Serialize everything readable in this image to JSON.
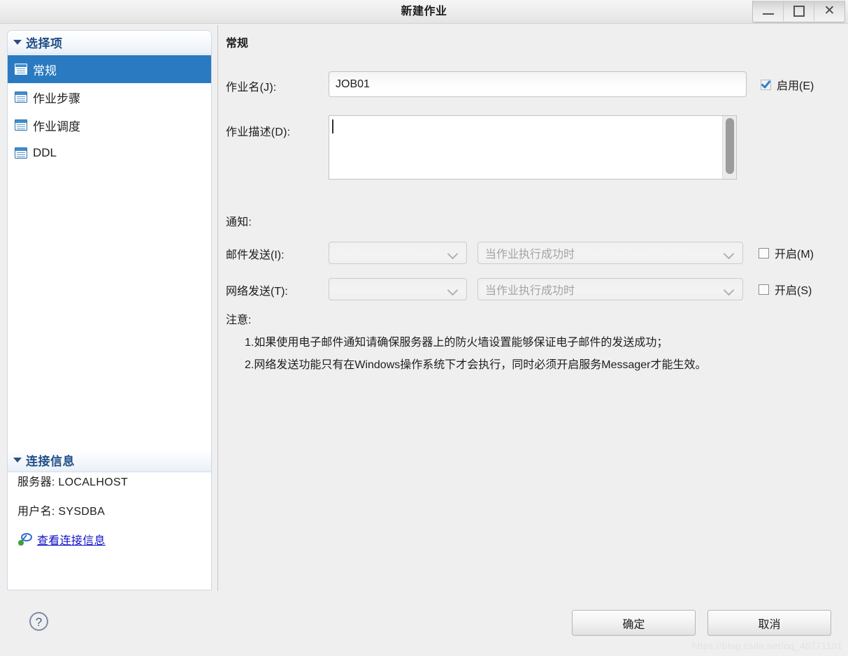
{
  "window": {
    "title": "新建作业",
    "minimize_label": "_",
    "maximize_label": "□",
    "close_label": "✕"
  },
  "sidebar": {
    "selection_section": {
      "title": "选择项",
      "items": [
        {
          "label": "常规",
          "icon": "list-form-icon",
          "selected": true
        },
        {
          "label": "作业步骤",
          "icon": "list-form-icon",
          "selected": false
        },
        {
          "label": "作业调度",
          "icon": "list-form-icon",
          "selected": false
        },
        {
          "label": "DDL",
          "icon": "list-form-icon",
          "selected": false
        }
      ]
    },
    "connection_section": {
      "title": "连接信息",
      "server_line": "服务器: LOCALHOST",
      "user_line": "用户名: SYSDBA",
      "link_label": "查看连接信息",
      "link_icon": "connection-icon"
    }
  },
  "main": {
    "panel_title": "常规",
    "job_name": {
      "label": "作业名(J):",
      "value": "JOB01",
      "placeholder": ""
    },
    "enable_checkbox": {
      "label": "启用(E)",
      "checked": true
    },
    "job_desc": {
      "label": "作业描述(D):",
      "value": "",
      "placeholder": ""
    },
    "notify": {
      "title": "通知:",
      "rows": [
        {
          "label": "邮件发送(I):",
          "target_value": "",
          "target_placeholder": "",
          "condition_value": "",
          "condition_placeholder": "当作业执行成功时",
          "checkbox_label": "开启(M)",
          "checked": false
        },
        {
          "label": "网络发送(T):",
          "target_value": "",
          "target_placeholder": "",
          "condition_value": "",
          "condition_placeholder": "当作业执行成功时",
          "checkbox_label": "开启(S)",
          "checked": false
        }
      ]
    },
    "notes": {
      "title": "注意:",
      "lines": [
        "1.如果使用电子邮件通知请确保服务器上的防火墙设置能够保证电子邮件的发送成功；",
        "2.网络发送功能只有在Windows操作系统下才会执行，同时必须开启服务Messager才能生效。"
      ]
    }
  },
  "footer": {
    "help_label": "?",
    "ok_label": "确定",
    "cancel_label": "取消",
    "watermark": "https://blog.csdn.net/qq_40771101"
  }
}
